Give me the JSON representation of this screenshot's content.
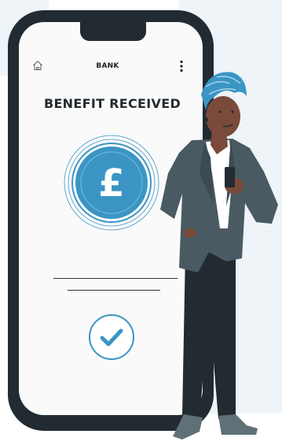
{
  "screen": {
    "title": "BANK",
    "headline": "BENEFIT RECEIVED",
    "currency_symbol": "£"
  },
  "icons": {
    "home": "home-icon",
    "menu": "kebab-menu-icon",
    "coin": "pound-coin-icon",
    "confirm": "checkmark-icon"
  },
  "colors": {
    "accent": "#3a95c4",
    "phone_frame": "#212b31",
    "screen_bg": "#fafafa"
  }
}
